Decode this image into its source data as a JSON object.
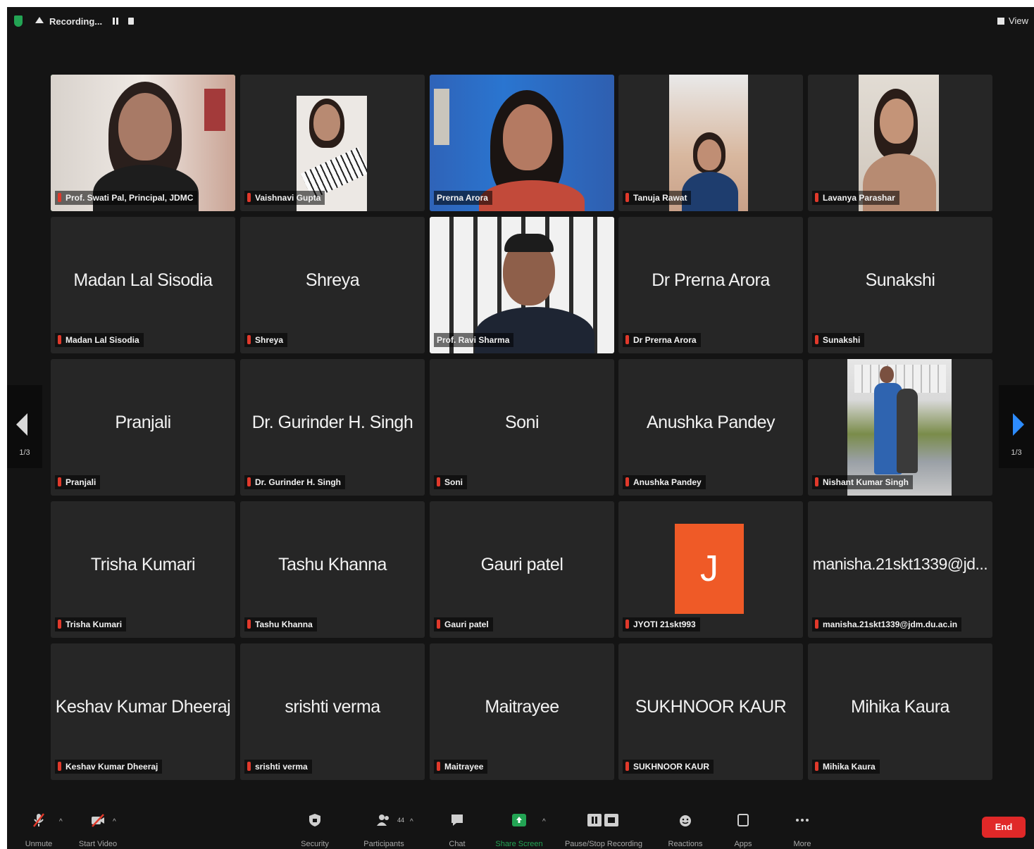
{
  "topbar": {
    "recording_label": "Recording...",
    "view_label": "View"
  },
  "navigation": {
    "left_page": "1/3",
    "right_page": "1/3"
  },
  "participants": [
    {
      "label": "Prof. Swati Pal, Principal, JDMC",
      "center": "",
      "video": true
    },
    {
      "label": "Vaishnavi Gupta",
      "center": "",
      "video": true
    },
    {
      "label": "Prerna Arora",
      "center": "",
      "video": true
    },
    {
      "label": "Tanuja Rawat",
      "center": "",
      "video": true
    },
    {
      "label": "Lavanya Parashar",
      "center": "",
      "video": true
    },
    {
      "label": "Madan Lal Sisodia",
      "center": "Madan Lal Sisodia"
    },
    {
      "label": "Shreya",
      "center": "Shreya"
    },
    {
      "label": "Prof. Ravi Sharma",
      "center": "",
      "video": true
    },
    {
      "label": "Dr Prerna Arora",
      "center": "Dr Prerna Arora"
    },
    {
      "label": "Sunakshi",
      "center": "Sunakshi"
    },
    {
      "label": "Pranjali",
      "center": "Pranjali"
    },
    {
      "label": "Dr. Gurinder H. Singh",
      "center": "Dr. Gurinder H. Singh"
    },
    {
      "label": "Soni",
      "center": "Soni"
    },
    {
      "label": "Anushka Pandey",
      "center": "Anushka Pandey"
    },
    {
      "label": "Nishant Kumar Singh",
      "center": "",
      "video": true
    },
    {
      "label": "Trisha Kumari",
      "center": "Trisha Kumari"
    },
    {
      "label": "Tashu Khanna",
      "center": "Tashu Khanna"
    },
    {
      "label": "Gauri patel",
      "center": "Gauri patel"
    },
    {
      "label": "JYOTI 21skt993",
      "center": "",
      "avatar_letter": "J"
    },
    {
      "label": "manisha.21skt1339@jdm.du.ac.in",
      "center": "manisha.21skt1339@jd..."
    },
    {
      "label": "Keshav Kumar Dheeraj",
      "center": "Keshav Kumar Dheeraj"
    },
    {
      "label": "srishti verma",
      "center": "srishti verma"
    },
    {
      "label": "Maitrayee",
      "center": "Maitrayee"
    },
    {
      "label": "SUKHNOOR KAUR",
      "center": "SUKHNOOR KAUR"
    },
    {
      "label": "Mihika Kaura",
      "center": "Mihika Kaura"
    }
  ],
  "toolbar": {
    "unmute": "Unmute",
    "start_video": "Start Video",
    "security": "Security",
    "participants": "Participants",
    "participants_count": "44",
    "chat": "Chat",
    "share_screen": "Share Screen",
    "recording": "Pause/Stop Recording",
    "reactions": "Reactions",
    "apps": "Apps",
    "more": "More",
    "end": "End"
  },
  "colors": {
    "active_speaker": "#3cc25a",
    "share_screen": "#23a454",
    "end": "#e02828",
    "avatar": "#ef5a27"
  }
}
